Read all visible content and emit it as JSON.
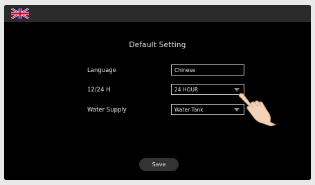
{
  "header": {
    "language_icon": "uk-flag-icon"
  },
  "title": "Default Setting",
  "settings": [
    {
      "label": "Language",
      "value": "Chinese",
      "has_dropdown": false
    },
    {
      "label": "12/24 H",
      "value": "24 HOUR",
      "has_dropdown": true
    },
    {
      "label": "Water Supply",
      "value": "Water Tank",
      "has_dropdown": true
    }
  ],
  "save_label": "Save",
  "colors": {
    "screen_bg": "#000000",
    "topbar_bg": "#2a2a2a",
    "text": "#e6e6e6",
    "field_border": "#cfcfcf",
    "button_bg": "#333333"
  }
}
